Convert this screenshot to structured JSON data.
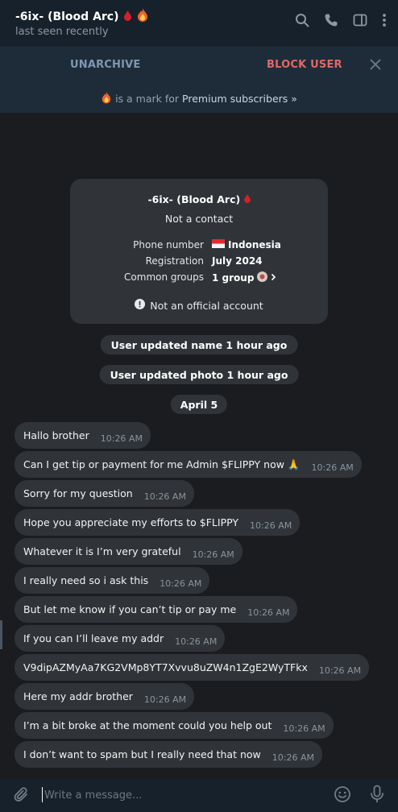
{
  "header": {
    "title": "-6ix- (Blood Arc)",
    "status": "last seen recently",
    "icons": [
      "search-icon",
      "phone-icon",
      "sidebar-toggle-icon",
      "more-vertical-icon"
    ]
  },
  "action_bar": {
    "unarchive_label": "UNARCHIVE",
    "block_label": "BLOCK USER"
  },
  "premium_notice": {
    "text": "is a mark for",
    "link": "Premium subscribers »"
  },
  "info_card": {
    "name": "-6ix- (Blood Arc)",
    "contact_status": "Not a contact",
    "rows": [
      {
        "label": "Phone number",
        "value": "Indonesia"
      },
      {
        "label": "Registration",
        "value": "July 2024"
      },
      {
        "label": "Common groups",
        "value": "1 group"
      }
    ],
    "official_note": "Not an official account"
  },
  "service_messages": [
    "User updated name 1 hour ago",
    "User updated photo 1 hour ago"
  ],
  "date_separator": "April 5",
  "messages": [
    {
      "text": "Hallo brother",
      "time": "10:26 AM"
    },
    {
      "text": "Can I get tip or payment for me Admin $FLIPPY now 🙏",
      "time": "10:26 AM"
    },
    {
      "text": "Sorry for my question",
      "time": "10:26 AM"
    },
    {
      "text": "Hope you appreciate my efforts to $FLIPPY",
      "time": "10:26 AM"
    },
    {
      "text": "Whatever it is I’m very grateful",
      "time": "10:26 AM"
    },
    {
      "text": "I really need so i ask this",
      "time": "10:26 AM"
    },
    {
      "text": "But let me know if you can’t tip or pay me",
      "time": "10:26 AM"
    },
    {
      "text": "If you can I’ll leave my addr",
      "time": "10:26 AM"
    },
    {
      "text": "V9dipAZMyAa7KG2VMp8YT7Xvvu8uZW4n1ZgE2WyTFkx",
      "time": "10:26 AM"
    },
    {
      "text": "Here my addr brother",
      "time": "10:26 AM"
    },
    {
      "text": "I’m a bit broke at the moment could you help out",
      "time": "10:26 AM"
    },
    {
      "text": "I don’t want to spam but I really need that now",
      "time": "10:26 AM"
    }
  ],
  "composer": {
    "placeholder": "Write a message..."
  },
  "colors": {
    "header_bg": "#17212b",
    "bar_bg": "#1e2c3a",
    "chat_bg": "#1a1c1f",
    "bubble_bg": "#303438",
    "accent": "#7e98b0",
    "danger": "#e06967"
  }
}
